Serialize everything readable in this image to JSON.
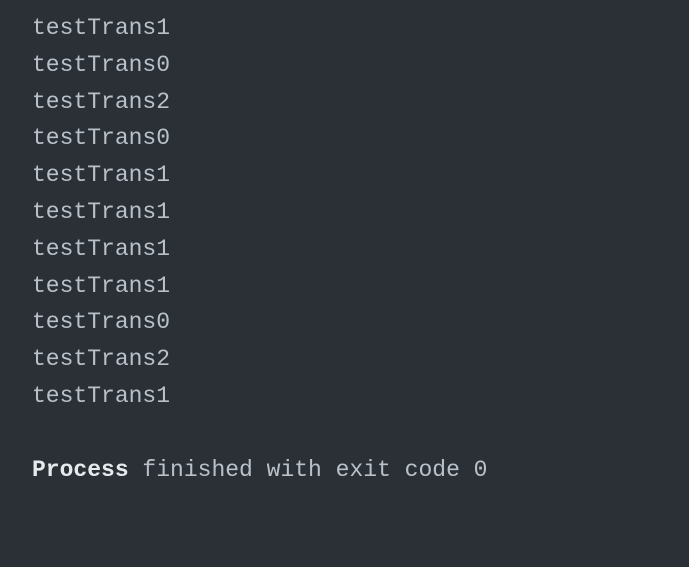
{
  "output_lines": [
    "testTrans1",
    "testTrans0",
    "testTrans2",
    "testTrans0",
    "testTrans1",
    "testTrans1",
    "testTrans1",
    "testTrans1",
    "testTrans0",
    "testTrans2",
    "testTrans1"
  ],
  "status": {
    "prefix": "Process",
    "rest": " finished with exit code 0"
  }
}
